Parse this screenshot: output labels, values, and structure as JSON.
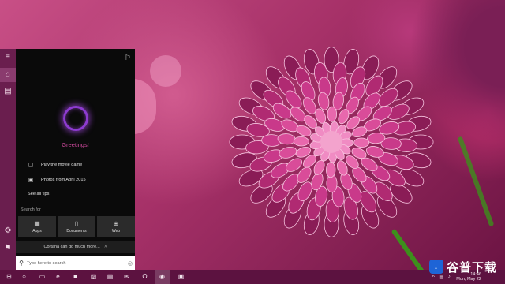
{
  "sidebar": {
    "items": [
      {
        "icon": "hamburger-menu-icon",
        "glyph": "≡"
      },
      {
        "icon": "home-icon",
        "glyph": "⌂"
      },
      {
        "icon": "notebook-icon",
        "glyph": "▤"
      },
      {
        "icon": "settings-gear-icon",
        "glyph": "⚙"
      },
      {
        "icon": "feedback-icon",
        "glyph": "⚑"
      }
    ]
  },
  "cortana": {
    "greeting": "Greetings!",
    "suggestions": [
      {
        "label": "Play the movie game",
        "icon": "film-icon",
        "glyph": "▢"
      },
      {
        "label": "Photos from April 2015",
        "icon": "photo-icon",
        "glyph": "▣"
      }
    ],
    "see_all": "See all tips",
    "search_for": "Search for",
    "categories": [
      {
        "label": "Apps",
        "icon": "apps-icon",
        "glyph": "▦"
      },
      {
        "label": "Documents",
        "icon": "document-icon",
        "glyph": "▯"
      },
      {
        "label": "Web",
        "icon": "globe-icon",
        "glyph": "⊕"
      }
    ],
    "more": "Cortana can do much more...",
    "more_chevron": "˄"
  },
  "search": {
    "placeholder": "Type here to search",
    "icon_glyph": "⚲",
    "mic_glyph": "◎"
  },
  "taskbar": {
    "apps": [
      {
        "icon": "windows-start-icon",
        "glyph": "⊞"
      },
      {
        "icon": "cortana-circle-icon",
        "glyph": "○"
      },
      {
        "icon": "task-view-icon",
        "glyph": "▭"
      },
      {
        "icon": "edge-browser-icon",
        "glyph": "e"
      },
      {
        "icon": "file-explorer-icon",
        "glyph": "■"
      },
      {
        "icon": "store-icon",
        "glyph": "▨"
      },
      {
        "icon": "word-doc-icon",
        "glyph": "▤"
      },
      {
        "icon": "mail-icon",
        "glyph": "✉"
      },
      {
        "icon": "opera-browser-icon",
        "glyph": "O"
      },
      {
        "icon": "chrome-browser-icon",
        "glyph": "◉"
      },
      {
        "icon": "app-window-icon",
        "glyph": "▣"
      }
    ],
    "clock_time": "14:46",
    "clock_date": "Mon, May 22"
  },
  "watermark": {
    "logo_glyph": "↓",
    "text": "谷普下载"
  },
  "colors": {
    "accent": "#8d3bd0",
    "greeting": "#d14a9e",
    "taskbar": "#5c1240",
    "rail": "#6a1e4e"
  }
}
